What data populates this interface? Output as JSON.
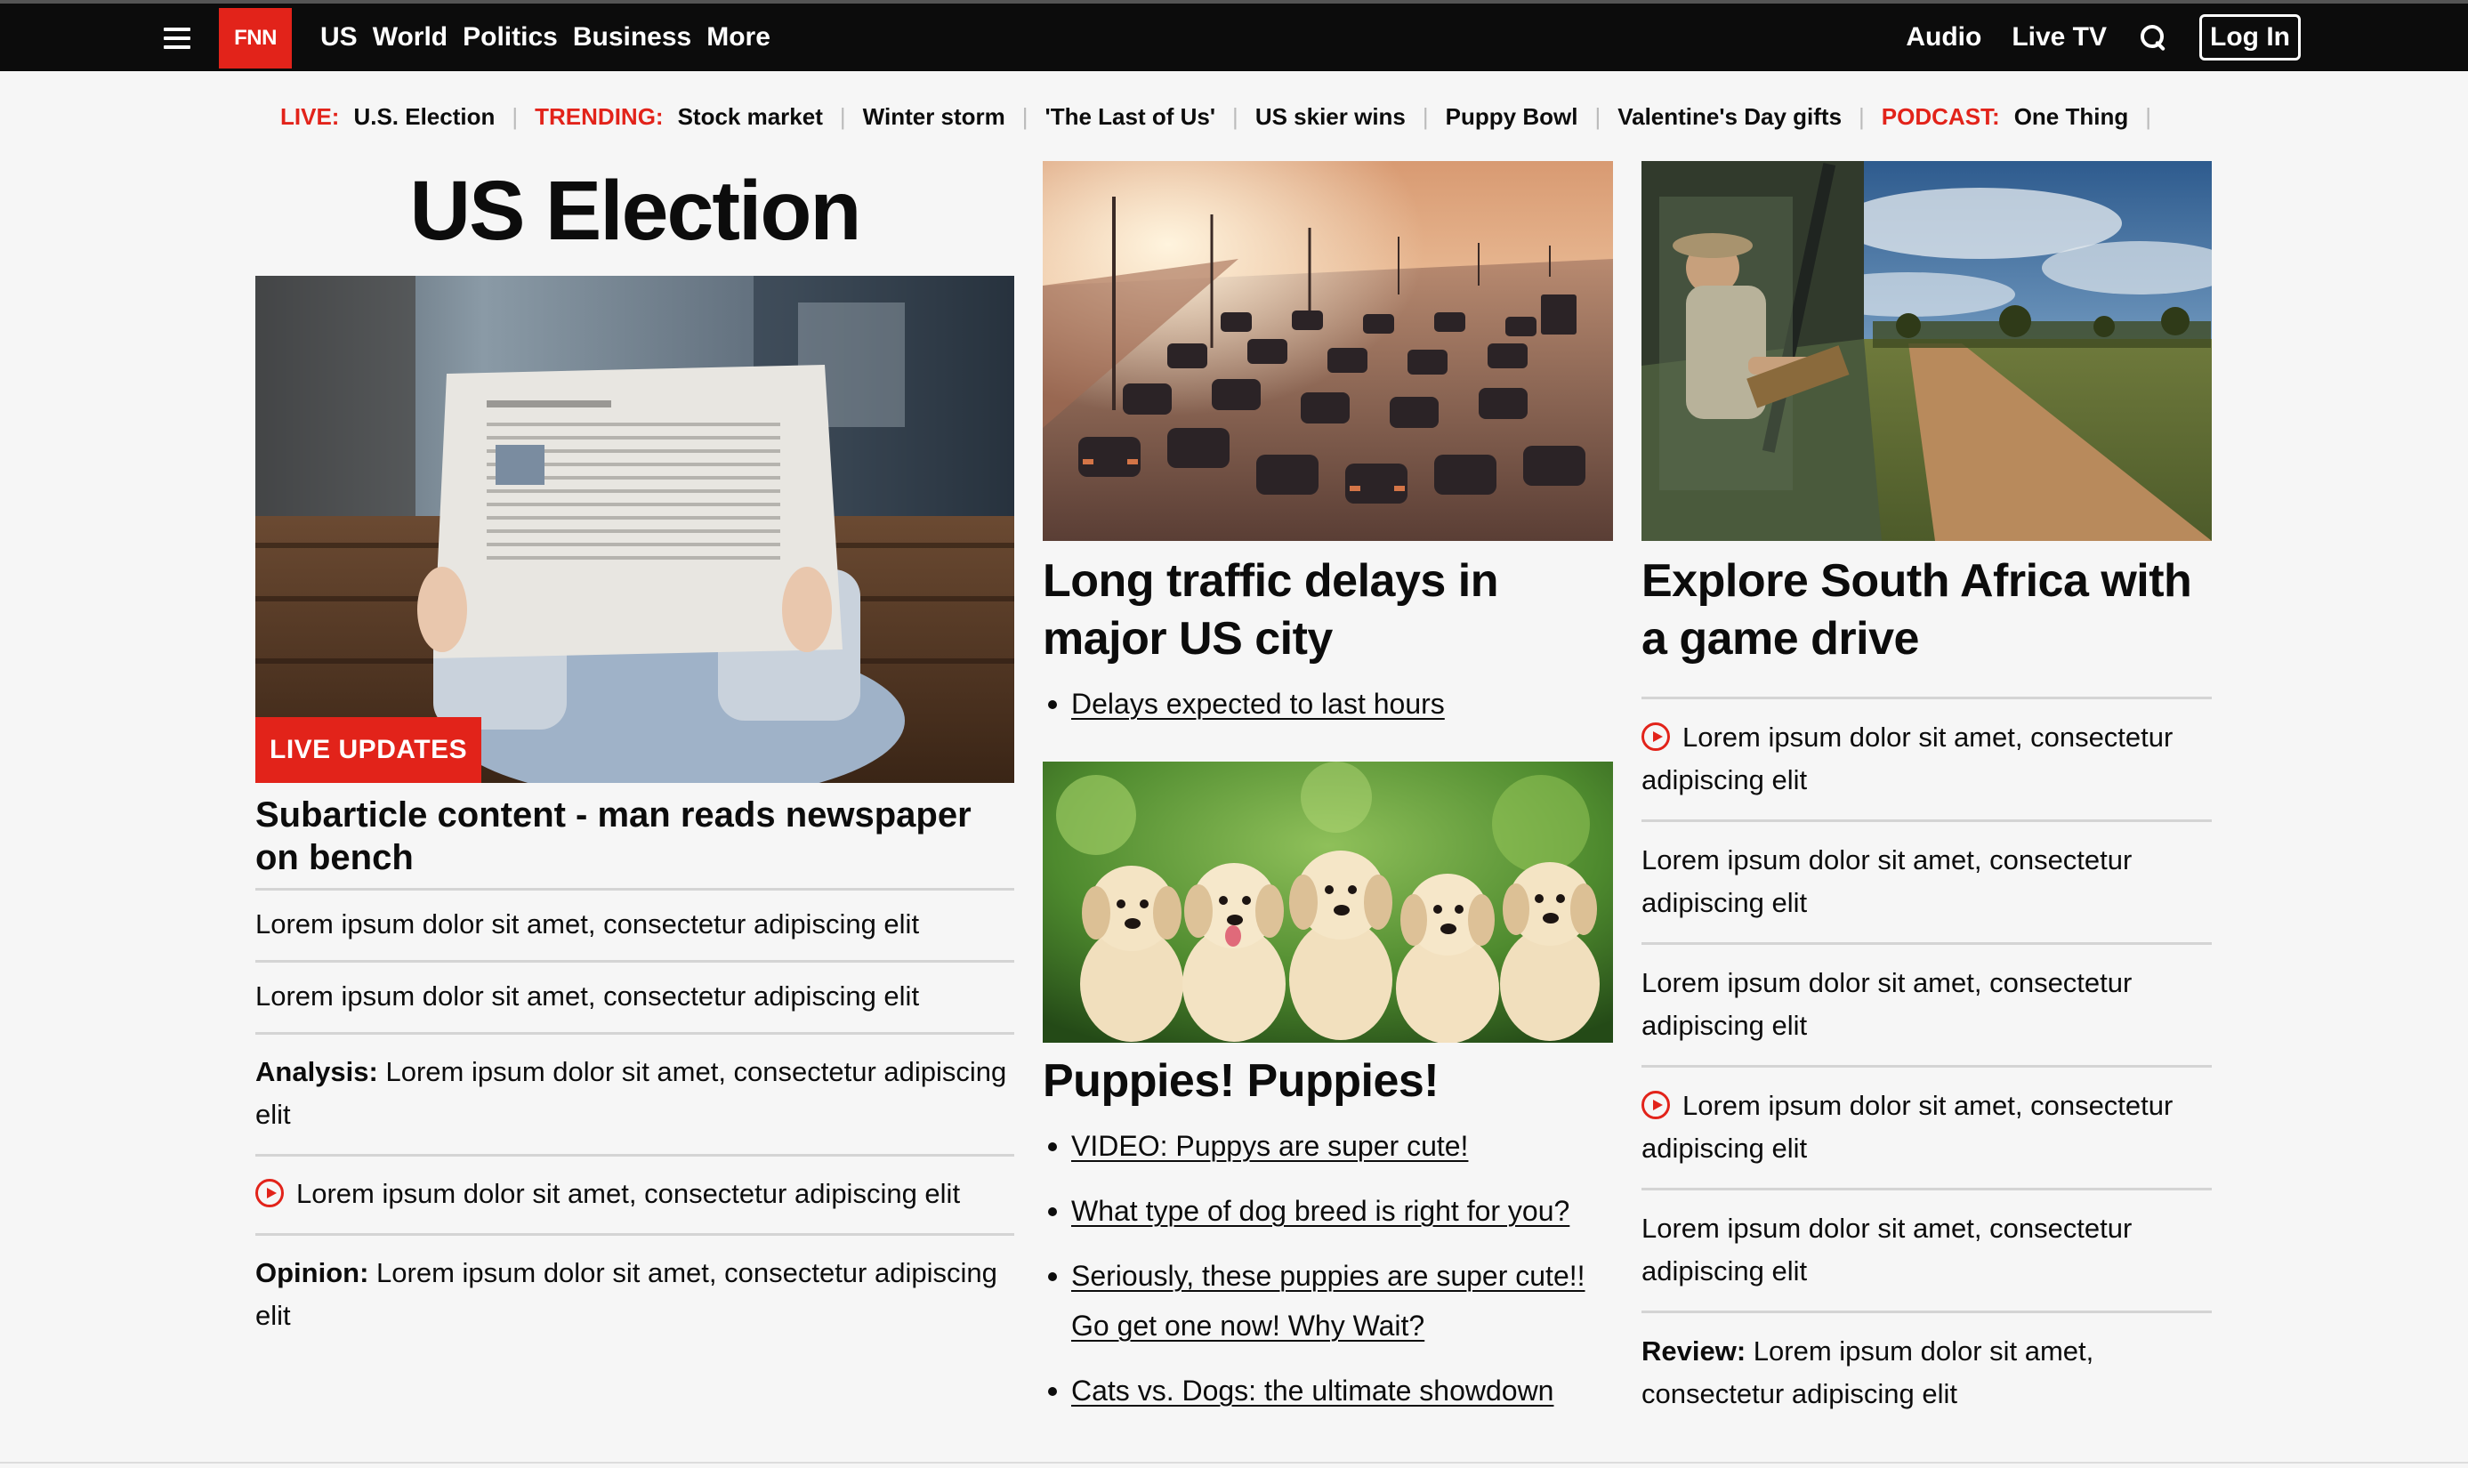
{
  "nav": {
    "logo": "FNN",
    "links": [
      "US",
      "World",
      "Politics",
      "Business",
      "More"
    ],
    "audio": "Audio",
    "live_tv": "Live TV",
    "login": "Log In"
  },
  "trending": {
    "live_label": "LIVE:",
    "live_item": "U.S. Election",
    "trending_label": "TRENDING:",
    "trending_items": [
      "Stock market",
      "Winter storm",
      "'The Last of Us'",
      "US skier wins",
      "Puppy Bowl",
      "Valentine's Day gifts"
    ],
    "podcast_label": "PODCAST:",
    "podcast_item": "One Thing"
  },
  "col1": {
    "title": "US Election",
    "badge": "LIVE UPDATES",
    "headline": "Subarticle content - man reads newspaper on bench",
    "items": [
      {
        "prefix": "",
        "text": "Lorem ipsum dolor sit amet, consectetur adipiscing elit",
        "video": false
      },
      {
        "prefix": "",
        "text": "Lorem ipsum dolor sit amet, consectetur adipiscing elit",
        "video": false
      },
      {
        "prefix": "Analysis:",
        "text": "Lorem ipsum dolor sit amet, consectetur adipiscing elit",
        "video": false
      },
      {
        "prefix": "",
        "text": "Lorem ipsum dolor sit amet, consectetur adipiscing elit",
        "video": true
      },
      {
        "prefix": "Opinion:",
        "text": "Lorem ipsum dolor sit amet, consectetur adipiscing elit",
        "video": false
      }
    ]
  },
  "col2": {
    "traffic_headline": "Long traffic delays in major US city",
    "traffic_bullets": [
      "Delays expected to last hours"
    ],
    "puppies_headline": "Puppies! Puppies!",
    "puppies_bullets": [
      "VIDEO: Puppys are super cute!",
      "What type of dog breed is right for you?",
      "Seriously, these puppies are super cute!! Go get one now! Why Wait?",
      "Cats vs. Dogs: the ultimate showdown"
    ]
  },
  "col3": {
    "headline": "Explore South Africa with a game drive",
    "items": [
      {
        "prefix": "",
        "text": "Lorem ipsum dolor sit amet, consectetur adipiscing elit",
        "video": true
      },
      {
        "prefix": "",
        "text": "Lorem ipsum dolor sit amet, consectetur adipiscing elit",
        "video": false
      },
      {
        "prefix": "",
        "text": "Lorem ipsum dolor sit amet, consectetur adipiscing elit",
        "video": false
      },
      {
        "prefix": "",
        "text": "Lorem ipsum dolor sit amet, consectetur adipiscing elit",
        "video": true
      },
      {
        "prefix": "",
        "text": "Lorem ipsum dolor sit amet, consectetur adipiscing elit",
        "video": false
      },
      {
        "prefix": "Review:",
        "text": "Lorem ipsum dolor sit amet, consectetur adipiscing elit",
        "video": false
      }
    ]
  },
  "colors": {
    "brand_red": "#e2231a",
    "nav_bg": "#0c0c0c",
    "page_bg": "#f6f6f6"
  }
}
